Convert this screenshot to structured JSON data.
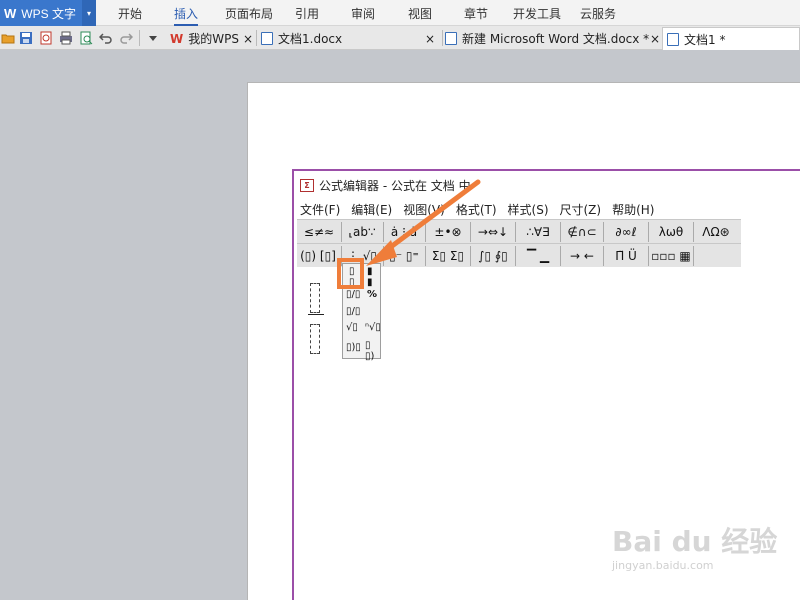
{
  "app": {
    "logo": "W",
    "name": "WPS 文字",
    "drop": "▾",
    "brand_color": "#3a77cc"
  },
  "ribbon": {
    "tabs": [
      "开始",
      "插入",
      "页面布局",
      "引用",
      "审阅",
      "视图",
      "章节",
      "开发工具",
      "云服务"
    ],
    "active": "插入"
  },
  "quick_toolbar": {
    "icons": [
      "open-folder-icon",
      "save-icon",
      "export-pdf-icon",
      "print-icon",
      "print-preview-icon",
      "undo-icon",
      "redo-icon",
      "more-dropdown-icon"
    ]
  },
  "doc_tabs": [
    {
      "label": "我的WPS",
      "close": "×"
    },
    {
      "label": "文档1.docx",
      "close": "×"
    },
    {
      "label": "新建 Microsoft Word 文档.docx *",
      "close": "×"
    },
    {
      "label": "文档1 *"
    }
  ],
  "equation_editor": {
    "title": "公式编辑器 - 公式在 文档 中",
    "menu": [
      "文件(F)",
      "编辑(E)",
      "视图(V)",
      "格式(T)",
      "样式(S)",
      "尺寸(Z)",
      "帮助(H)"
    ],
    "toolbar_row1": [
      "≤≠≈",
      "∴∀∃",
      "±•⊗",
      "→⇔↓",
      "∴∀∃",
      "∉∩⊂",
      "∂∞ℓ",
      "λωθ",
      "ΛΩ⊛"
    ],
    "accent_color": "#9b4fa8"
  },
  "annotation": {
    "arrow_color": "#ef7d3a"
  },
  "watermark": {
    "big": "Bai du 经验",
    "small": "jingyan.baidu.com"
  }
}
